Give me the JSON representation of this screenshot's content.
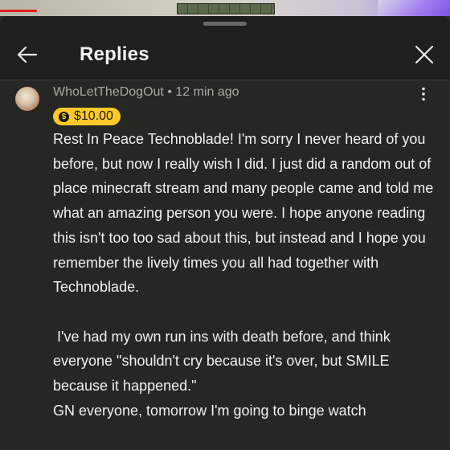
{
  "header": {
    "title": "Replies"
  },
  "comment": {
    "author": "WhoLetTheDogOut",
    "separator": "•",
    "time": "12 min ago",
    "super_thanks": "$10.00",
    "paragraphs": [
      "Rest In Peace Technoblade! I'm sorry I never heard of you before, but now I really wish I did. I just did a random out of place minecraft stream and many people came and told me what an amazing person you were. I hope anyone reading this isn't too too sad about this, but instead and I hope you remember the lively times you all had together with Technoblade.",
      " I've had my own run ins with death before, and think everyone \"shouldn't cry because it's over, but SMILE because it happened.\"",
      "GN everyone, tomorrow I'm going to binge watch"
    ]
  },
  "icons": {
    "back": "arrow-left-icon",
    "close": "close-icon",
    "more": "more-vert-icon",
    "coin": "super-thanks-coin-icon"
  },
  "colors": {
    "sheet_bg": "#1f1f1d",
    "comment_bg": "#262622",
    "badge_bg": "#ffca28",
    "text": "#f1f1ee",
    "meta_text": "#a9a9a3"
  }
}
